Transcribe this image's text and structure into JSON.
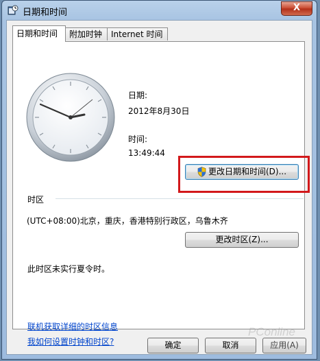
{
  "window": {
    "title": "日期和时间",
    "close_label": "X"
  },
  "tabs": [
    {
      "label": "日期和时间",
      "active": true
    },
    {
      "label": "附加时钟",
      "active": false
    },
    {
      "label": "Internet 时间",
      "active": false
    }
  ],
  "datetime": {
    "date_label": "日期:",
    "date_value": "2012年8月30日",
    "time_label": "时间:",
    "time_value": "13:49:44",
    "change_button": "更改日期和时间(D)..."
  },
  "timezone": {
    "section_label": "时区",
    "value": "(UTC+08:00)北京，重庆，香港特别行政区，乌鲁木齐",
    "change_button": "更改时区(Z)...",
    "dst_note": "此时区未实行夏令时。"
  },
  "links": {
    "online_info": "联机获取详细的时区信息",
    "how_to": "我如何设置时钟和时区?"
  },
  "footer": {
    "ok": "确定",
    "cancel": "取消",
    "apply": "应用(A)"
  },
  "watermark": "PConline",
  "colors": {
    "highlight_box": "#d2181b",
    "link": "#0044cc"
  }
}
